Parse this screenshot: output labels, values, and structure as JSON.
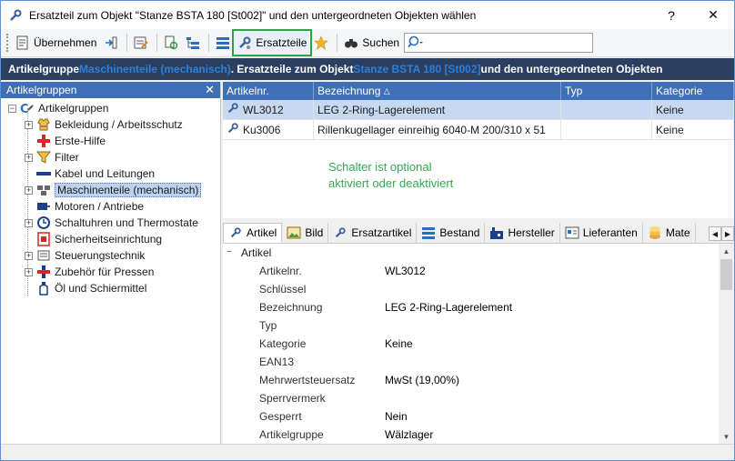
{
  "window": {
    "title": "Ersatzteil zum Objekt \"Stanze BSTA 180 [St002]\" und den untergeordneten Objekten wählen",
    "help_label": "?",
    "close_label": "✕"
  },
  "toolbar": {
    "uebernehmen_label": "Übernehmen",
    "ersatzteile_label": "Ersatzteile",
    "suchen_label": "Suchen",
    "search_value": ""
  },
  "headband": {
    "prefix": "Artikelgruppe ",
    "group": "Maschinenteile (mechanisch)",
    "middle": ". Ersatzteile zum Objekt ",
    "object": "Stanze BSTA 180 [St002]",
    "suffix": " und den untergeordneten Objekten"
  },
  "tree": {
    "header": "Artikelgruppen",
    "close_label": "✕",
    "root": "Artikelgruppen",
    "items": [
      {
        "label": "Bekleidung / Arbeitsschutz"
      },
      {
        "label": "Erste-Hilfe"
      },
      {
        "label": "Filter"
      },
      {
        "label": "Kabel und Leitungen"
      },
      {
        "label": "Maschinenteile (mechanisch)"
      },
      {
        "label": "Motoren / Antriebe"
      },
      {
        "label": "Schaltuhren und Thermostate"
      },
      {
        "label": "Sicherheitseinrichtung"
      },
      {
        "label": "Steuerungstechnik"
      },
      {
        "label": "Zubehör für Pressen"
      },
      {
        "label": "Öl und Schiermittel"
      }
    ]
  },
  "grid": {
    "columns": [
      "Artikelnr.",
      "Bezeichnung",
      "Typ",
      "Kategorie"
    ],
    "sort_indicator": "△",
    "rows": [
      {
        "nr": "WL3012",
        "bezeichnung": "LEG 2-Ring-Lagerelement",
        "typ": "",
        "kategorie": "Keine"
      },
      {
        "nr": "Ku3006",
        "bezeichnung": "Rillenkugellager einreihig 6040-M 200/310 x 51",
        "typ": "",
        "kategorie": "Keine"
      }
    ]
  },
  "annotation": {
    "line1": "Schalter ist optional",
    "line2": "aktiviert oder deaktiviert"
  },
  "tabs": [
    "Artikel",
    "Bild",
    "Ersatzartikel",
    "Bestand",
    "Hersteller",
    "Lieferanten",
    "Mate"
  ],
  "properties": {
    "group": "Artikel",
    "rows": [
      {
        "key": "Artikelnr.",
        "value": "WL3012"
      },
      {
        "key": "Schlüssel",
        "value": ""
      },
      {
        "key": "Bezeichnung",
        "value": "LEG 2-Ring-Lagerelement"
      },
      {
        "key": "Typ",
        "value": ""
      },
      {
        "key": "Kategorie",
        "value": "Keine"
      },
      {
        "key": "EAN13",
        "value": ""
      },
      {
        "key": "Mehrwertsteuersatz",
        "value": "MwSt (19,00%)"
      },
      {
        "key": "Sperrvermerk",
        "value": ""
      },
      {
        "key": "Gesperrt",
        "value": "Nein"
      },
      {
        "key": "Artikelgruppe",
        "value": "Wälzlager"
      }
    ]
  },
  "colors": {
    "headband_bg": "#2b3f61",
    "accent": "#2f7fd6",
    "panel_header": "#3f6fb6",
    "highlight_outline": "#2fa34a",
    "annotation_text": "#34a853"
  }
}
